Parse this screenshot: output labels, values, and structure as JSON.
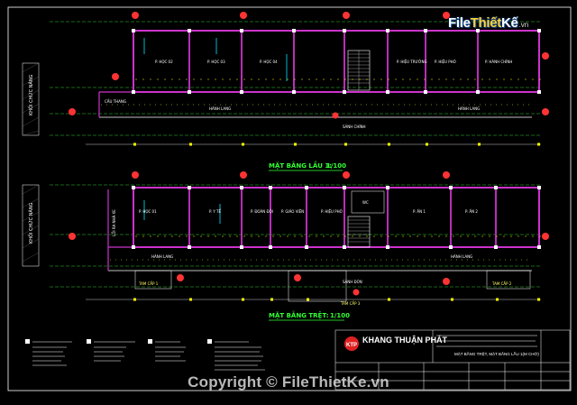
{
  "logo": {
    "prefix": "File",
    "highlight": "Thiết",
    "suffix": "Kế",
    "domain": ".vn"
  },
  "watermark": "Copyright © FileThietKe.vn",
  "plans": [
    {
      "title": "MẶT BẰNG LẦU 1: ",
      "scale": "1/100",
      "side_label": "KHỐI CHỨC NĂNG",
      "rooms": [
        "P. HỌC 02",
        "P. HỌC 03",
        "P. HỌC 04",
        "P. HIỆU TRƯỞNG",
        "P. HIỆU PHÓ",
        "P. HÀNH CHÍNH"
      ],
      "corridor": [
        "HÀNH LANG",
        "HÀNH LANG"
      ],
      "misc": [
        "SẢNH CHÍNH",
        "CẦU THANG"
      ]
    },
    {
      "title": "MẶT BẰNG TRỆT: ",
      "scale": "1/100",
      "side_label": "KHỐI CHỨC NĂNG",
      "rooms": [
        "P. HỌC 01",
        "P. Y TẾ",
        "P. ĐOÀN ĐỘI",
        "P. GIÁO VIÊN",
        "P. HIỆU PHÓ",
        "WC",
        "P. ĂN 1",
        "P. ĂN 2"
      ],
      "corridor": [
        "HÀNH LANG",
        "HÀNH LANG"
      ],
      "misc": [
        "LỐI RA NHÀ XE",
        "TAM CẤP 1",
        "TAM CẤP 2",
        "TAM CẤP 3",
        "SẢNH ĐÓN"
      ]
    }
  ],
  "company": "KHANG THUẬN PHÁT",
  "sheet_title": "MẶT BẰNG TRỆT, MẶT BẰNG LẦU 1(M CHỜ)",
  "colors": {
    "background": "#000000",
    "walls": "#cc33cc",
    "columns": "#ffffff",
    "grid": "#33cc33",
    "yellow": "#ffff00",
    "axis_red": "#ff3333"
  }
}
